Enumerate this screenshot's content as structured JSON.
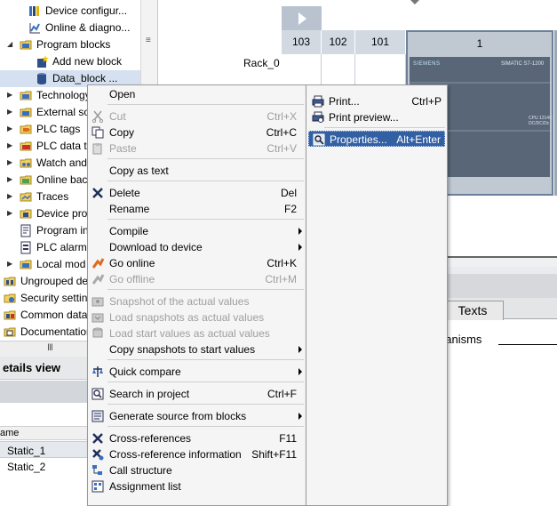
{
  "project_tree": {
    "items": [
      {
        "label": "Device configur...",
        "icon": "device-config-icon",
        "expander": ""
      },
      {
        "label": "Online & diagno...",
        "icon": "online-diagnostics-icon",
        "expander": ""
      },
      {
        "label": "Program blocks",
        "icon": "folder-icon",
        "expander": "expanded"
      },
      {
        "label": "Add new block",
        "icon": "add-block-icon",
        "expander": ""
      },
      {
        "label": "Data_block ...",
        "icon": "data-block-icon",
        "expander": ""
      },
      {
        "label": "Technology",
        "icon": "folder-icon",
        "expander": "collapsed"
      },
      {
        "label": "External so",
        "icon": "folder-icon",
        "expander": "collapsed"
      },
      {
        "label": "PLC tags",
        "icon": "plc-tags-icon",
        "expander": "collapsed"
      },
      {
        "label": "PLC data ty",
        "icon": "plc-data-types-icon",
        "expander": "collapsed"
      },
      {
        "label": "Watch and",
        "icon": "watch-tables-icon",
        "expander": "collapsed"
      },
      {
        "label": "Online bac",
        "icon": "online-backups-icon",
        "expander": "collapsed"
      },
      {
        "label": "Traces",
        "icon": "traces-icon",
        "expander": "collapsed"
      },
      {
        "label": "Device pro",
        "icon": "device-proxy-icon",
        "expander": "collapsed"
      },
      {
        "label": "Program in",
        "icon": "program-info-icon",
        "expander": ""
      },
      {
        "label": "PLC alarm",
        "icon": "plc-alarm-icon",
        "expander": ""
      },
      {
        "label": "Local mod",
        "icon": "folder-icon",
        "expander": "collapsed"
      },
      {
        "label": "Ungrouped de",
        "icon": "ungrouped-devices-icon",
        "expander": "collapsed"
      },
      {
        "label": "Security settin",
        "icon": "security-settings-icon",
        "expander": "collapsed"
      },
      {
        "label": "Common data",
        "icon": "common-data-icon",
        "expander": "collapsed"
      },
      {
        "label": "Documentation",
        "icon": "documentation-icon",
        "expander": "collapsed"
      }
    ]
  },
  "details_view": {
    "title": "etails view",
    "column_header": "ame",
    "rows": [
      "Static_1",
      "Static_2"
    ]
  },
  "device_view": {
    "rack_label": "Rack_0",
    "slots": [
      "103",
      "102",
      "101",
      "1"
    ],
    "cpu": {
      "brand": "SIEMENS",
      "model": "SIMATIC S7-1200",
      "label": "CPU 1214C\nDC/DC/Dc"
    }
  },
  "inspector": {
    "tab_label": "Texts",
    "field_label": "hanisms"
  },
  "context_menu": {
    "items": [
      {
        "label": "Open",
        "shortcut": "",
        "icon": "",
        "enabled": true,
        "submenu": false
      },
      {
        "sep": true
      },
      {
        "label": "Cut",
        "shortcut": "Ctrl+X",
        "icon": "cut-icon",
        "enabled": false,
        "submenu": false
      },
      {
        "label": "Copy",
        "shortcut": "Ctrl+C",
        "icon": "copy-icon",
        "enabled": true,
        "submenu": false
      },
      {
        "label": "Paste",
        "shortcut": "Ctrl+V",
        "icon": "paste-icon",
        "enabled": false,
        "submenu": false
      },
      {
        "sep": true
      },
      {
        "label": "Copy as text",
        "shortcut": "",
        "icon": "",
        "enabled": true,
        "submenu": false
      },
      {
        "sep": true
      },
      {
        "label": "Delete",
        "shortcut": "Del",
        "icon": "delete-icon",
        "enabled": true,
        "submenu": false
      },
      {
        "label": "Rename",
        "shortcut": "F2",
        "icon": "",
        "enabled": true,
        "submenu": false
      },
      {
        "sep": true
      },
      {
        "label": "Compile",
        "shortcut": "",
        "icon": "",
        "enabled": true,
        "submenu": true
      },
      {
        "label": "Download to device",
        "shortcut": "",
        "icon": "",
        "enabled": true,
        "submenu": true
      },
      {
        "label": "Go online",
        "shortcut": "Ctrl+K",
        "icon": "go-online-icon",
        "enabled": true,
        "submenu": false
      },
      {
        "label": "Go offline",
        "shortcut": "Ctrl+M",
        "icon": "go-offline-icon",
        "enabled": false,
        "submenu": false
      },
      {
        "sep": true
      },
      {
        "label": "Snapshot of the actual values",
        "shortcut": "",
        "icon": "snapshot-icon",
        "enabled": false,
        "submenu": false
      },
      {
        "label": "Load snapshots as actual values",
        "shortcut": "",
        "icon": "load-snapshot-icon",
        "enabled": false,
        "submenu": false
      },
      {
        "label": "Load start values as actual values",
        "shortcut": "",
        "icon": "load-start-values-icon",
        "enabled": false,
        "submenu": false
      },
      {
        "label": "Copy snapshots to start values",
        "shortcut": "",
        "icon": "",
        "enabled": true,
        "submenu": true
      },
      {
        "sep": true
      },
      {
        "label": "Quick compare",
        "shortcut": "",
        "icon": "quick-compare-icon",
        "enabled": true,
        "submenu": true
      },
      {
        "sep": true
      },
      {
        "label": "Search in project",
        "shortcut": "Ctrl+F",
        "icon": "search-icon",
        "enabled": true,
        "submenu": false
      },
      {
        "sep": true
      },
      {
        "label": "Generate source from blocks",
        "shortcut": "",
        "icon": "generate-source-icon",
        "enabled": true,
        "submenu": true
      },
      {
        "sep": true
      },
      {
        "label": "Cross-references",
        "shortcut": "F11",
        "icon": "cross-references-icon",
        "enabled": true,
        "submenu": false
      },
      {
        "label": "Cross-reference information",
        "shortcut": "Shift+F11",
        "icon": "cross-reference-info-icon",
        "enabled": true,
        "submenu": false
      },
      {
        "label": "Call structure",
        "shortcut": "",
        "icon": "call-structure-icon",
        "enabled": true,
        "submenu": false
      },
      {
        "label": "Assignment list",
        "shortcut": "",
        "icon": "assignment-list-icon",
        "enabled": true,
        "submenu": false
      }
    ]
  },
  "submenu": {
    "items": [
      {
        "label": "Print...",
        "shortcut": "Ctrl+P",
        "icon": "print-icon",
        "highlighted": false
      },
      {
        "label": "Print preview...",
        "shortcut": "",
        "icon": "print-preview-icon",
        "highlighted": false
      },
      {
        "sep": true
      },
      {
        "label": "Properties...",
        "shortcut": "Alt+Enter",
        "icon": "properties-icon",
        "highlighted": true
      }
    ]
  },
  "colors": {
    "menu_highlight": "#3360a3",
    "selection": "#d5e1f1",
    "slot_header": "#d3d9e1",
    "cpu_body": "#586677"
  }
}
